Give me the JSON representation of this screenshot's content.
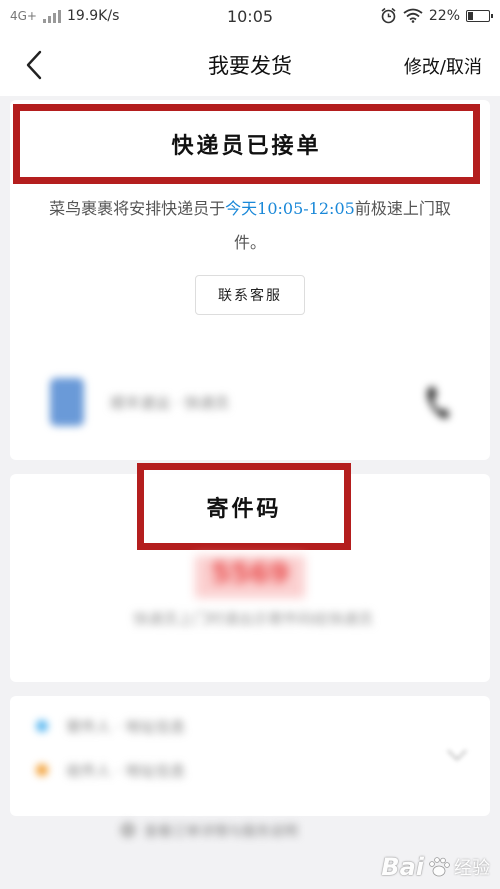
{
  "status_bar": {
    "network": "4G+",
    "speed": "19.9K/s",
    "time": "10:05",
    "battery": "22%",
    "battery_level": 0.22,
    "icons": [
      "signal-icon",
      "alarm-icon",
      "wifi-icon",
      "battery-icon"
    ]
  },
  "navbar": {
    "title": "我要发货",
    "action": "修改/取消"
  },
  "order_status": {
    "heading": "快递员已接单",
    "desc_prefix": "菜鸟裹裹将安排快递员于",
    "desc_time": "今天10:05-12:05",
    "desc_suffix": "前极速上门取件。",
    "contact_button": "联系客服",
    "courier_info": "顺丰速运 · 快递员"
  },
  "pickup_code": {
    "heading": "寄件码",
    "code": "5569",
    "hint": "快递员上门时请出示寄件码给快递员"
  },
  "shipment": {
    "sender": "寄件人 · 地址信息",
    "receiver": "收件人 · 地址信息",
    "footer": "查看订单详情与服务说明"
  },
  "watermark": {
    "brand": "Bai",
    "suffix": "经验"
  },
  "colors": {
    "highlight_border": "#b41e1e",
    "time_accent": "#1a88d8",
    "code_red": "#e84a4a"
  }
}
